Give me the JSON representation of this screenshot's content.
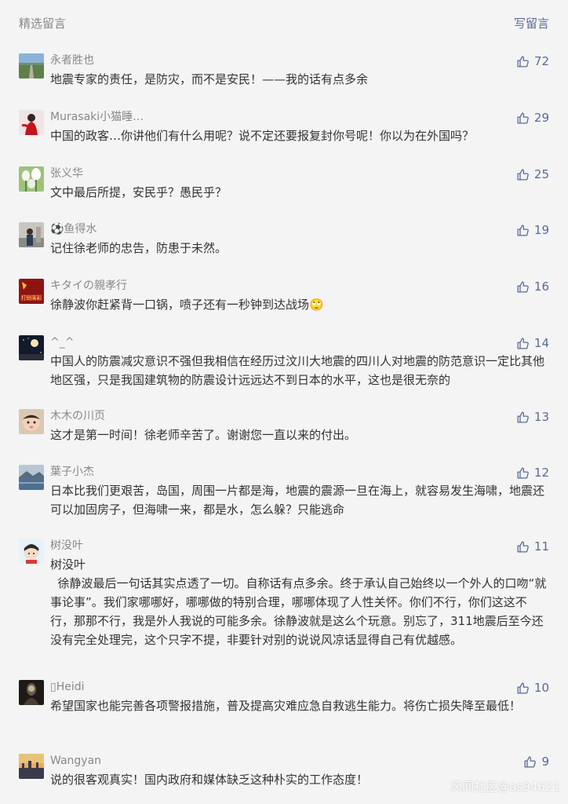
{
  "header": {
    "title": "精选留言",
    "write_label": "写留言"
  },
  "comments": [
    {
      "nickname": "永者胜也",
      "text": "地震专家的责任，是防灾，而不是安民！——我的话有点多余",
      "likes": "72",
      "avatar": "road-landscape"
    },
    {
      "nickname": "Murasaki小猫睡…",
      "text": "中国的政客…你讲他们有什么用呢？说不定还要报复封你号呢！你以为在外国吗？",
      "likes": "29",
      "avatar": "red-figure"
    },
    {
      "nickname": "张义华",
      "text": "文中最后所提，安民乎？愚民乎？",
      "likes": "25",
      "avatar": "white-tulips"
    },
    {
      "nickname": "⚽鱼得水",
      "text": "记住徐老师的忠告，防患于未然。",
      "likes": "19",
      "avatar": "person-photo"
    },
    {
      "nickname": "キタイの親孝行",
      "text": "徐静波你赶紧背一口锅，喷子还有一秒钟到达战场🙄",
      "likes": "16",
      "avatar": "red-banner",
      "avatar_text": "打倒落彩"
    },
    {
      "nickname": "^_^",
      "text": "中国人的防震减灾意识不强但我相信在经历过汶川大地震的四川人对地震的防范意识一定比其他地区强，只是我国建筑物的防震设计远远达不到日本的水平，这也是很无奈的",
      "likes": "14",
      "avatar": "night-sky"
    },
    {
      "nickname": "木木の川页",
      "text": "这才是第一时间！徐老师辛苦了。谢谢您一直以来的付出。",
      "likes": "13",
      "avatar": "baby-face"
    },
    {
      "nickname": "葉子小杰",
      "text": "日本比我们更艰苦，岛国，周围一片都是海，地震的震源一旦在海上，就容易发生海啸，地震还可以加固房子，但海啸一来，都是水，怎么躲？只能逃命",
      "likes": "12",
      "avatar": "sea-landscape"
    },
    {
      "nickname": "树没叶",
      "text": "树没叶\n  徐静波最后一句话其实点透了一切。自称话有点多余。终于承认自己始终以一个外人的口吻“就事论事”。我们家哪哪好，哪哪做的特别合理，哪哪体现了人性关怀。你们不行，你们这这不行，那那不行，我是外人我说的可能多余。徐静波就是这么个玩意。别忘了，311地震后至今还没有完全处理完，这个只字不提，非要针对别的说说风凉话显得自己有优越感。",
      "likes": "11",
      "avatar": "cartoon-girl"
    },
    {
      "nickname": "▯Heidi",
      "text": "希望国家也能完善各项警报措施，普及提高灾难应急自救逃生能力。将伤亡损失降至最低！",
      "likes": "10",
      "avatar": "dark-portrait"
    },
    {
      "nickname": "Wangyan",
      "text": "说的很客观真实！国内政府和媒体缺乏这种朴实的工作态度！",
      "likes": "9",
      "avatar": "sunset-city"
    }
  ],
  "watermark": "风闻社区@as94621",
  "colors": {
    "link": "#576b95",
    "text": "#333333",
    "meta": "#888888",
    "background": "#f4f4f4"
  }
}
